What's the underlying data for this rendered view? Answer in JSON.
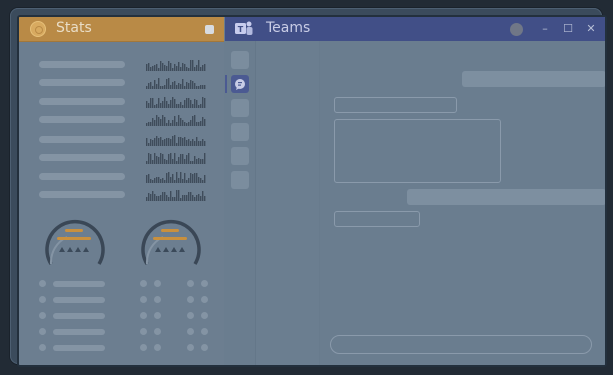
{
  "stats_window": {
    "title": "Stats",
    "accent": "#b98a46",
    "icon": "stats-logo-icon"
  },
  "teams_window": {
    "title": "Teams",
    "accent": "#414f87",
    "icon": "teams-logo-icon",
    "controls": {
      "minimize": "–",
      "maximize": "☐",
      "close": "✕"
    },
    "rail_items": [
      "activity-icon",
      "chat-icon",
      "teams-icon",
      "calendar-icon",
      "calls-icon",
      "files-icon"
    ],
    "active_rail_index": 1
  }
}
